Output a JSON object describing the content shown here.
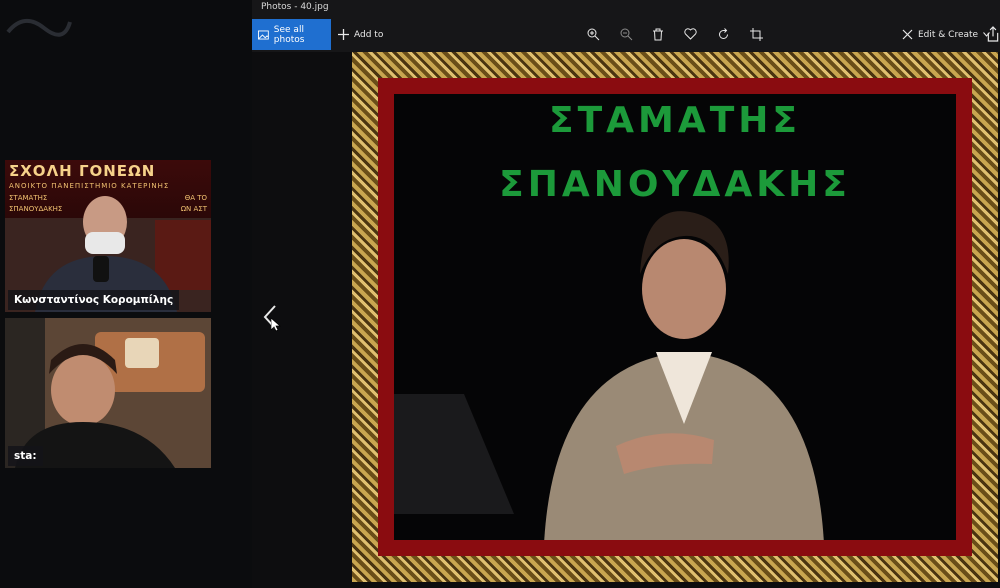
{
  "window": {
    "title": "Photos - 40.jpg"
  },
  "toolbar": {
    "see_all_label": "See all photos",
    "add_to_label": "Add to",
    "zoom_in_icon": "zoom-in-icon",
    "zoom_out_icon": "zoom-out-icon",
    "delete_icon": "trash-icon",
    "favorite_icon": "heart-icon",
    "rotate_icon": "rotate-icon",
    "crop_icon": "crop-icon",
    "edit_label": "Edit & Create"
  },
  "photo": {
    "title_line1": "ΣΤΑΜΑΤΗΣ",
    "title_line2": "ΣΠΑΝΟΥΔΑΚΗΣ"
  },
  "call": {
    "banner_line1": "ΣΧΟΛΗ ΓΟΝΕΩΝ",
    "banner_line2": "ΑΝΟΙΚΤΟ ΠΑΝΕΠΙΣΤΗΜΙΟ ΚΑΤΕΡΙΝΗΣ",
    "banner_line3": "ΣΤΑΜΑΤΗΣ",
    "banner_line4": "ΣΠΑΝΟΥΔΑΚΗΣ",
    "banner_right1": "ΘΑ ΤΟ",
    "banner_right2": "ΩΝ ΑΣΤ",
    "participant1_name": "Κωνσταντίνος Κορομπίλης",
    "participant2_name": "sta:"
  },
  "colors": {
    "accent": "#1f6fd0",
    "title_green": "#1c9a3a",
    "frame_red": "#8a0c10"
  }
}
